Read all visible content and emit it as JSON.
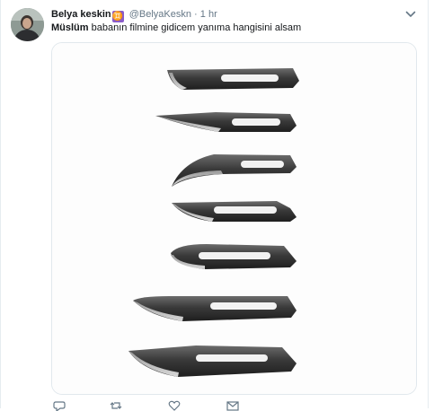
{
  "tweet": {
    "display_name": "Belya keskin",
    "badge": "♊",
    "handle": "@BelyaKeskn",
    "separator": "·",
    "timestamp": "1 hr",
    "mention": "Müslüm",
    "text": " babanın filmine gidicem yanıma hangisini alsam"
  },
  "icons": {
    "menu": "chevron-down-icon",
    "reply": "reply-icon",
    "retweet": "retweet-icon",
    "like": "heart-icon",
    "message": "envelope-icon"
  },
  "colors": {
    "text": "#14171a",
    "secondary": "#657786",
    "border": "#e1e8ed",
    "badge": "#8a5cc9"
  }
}
